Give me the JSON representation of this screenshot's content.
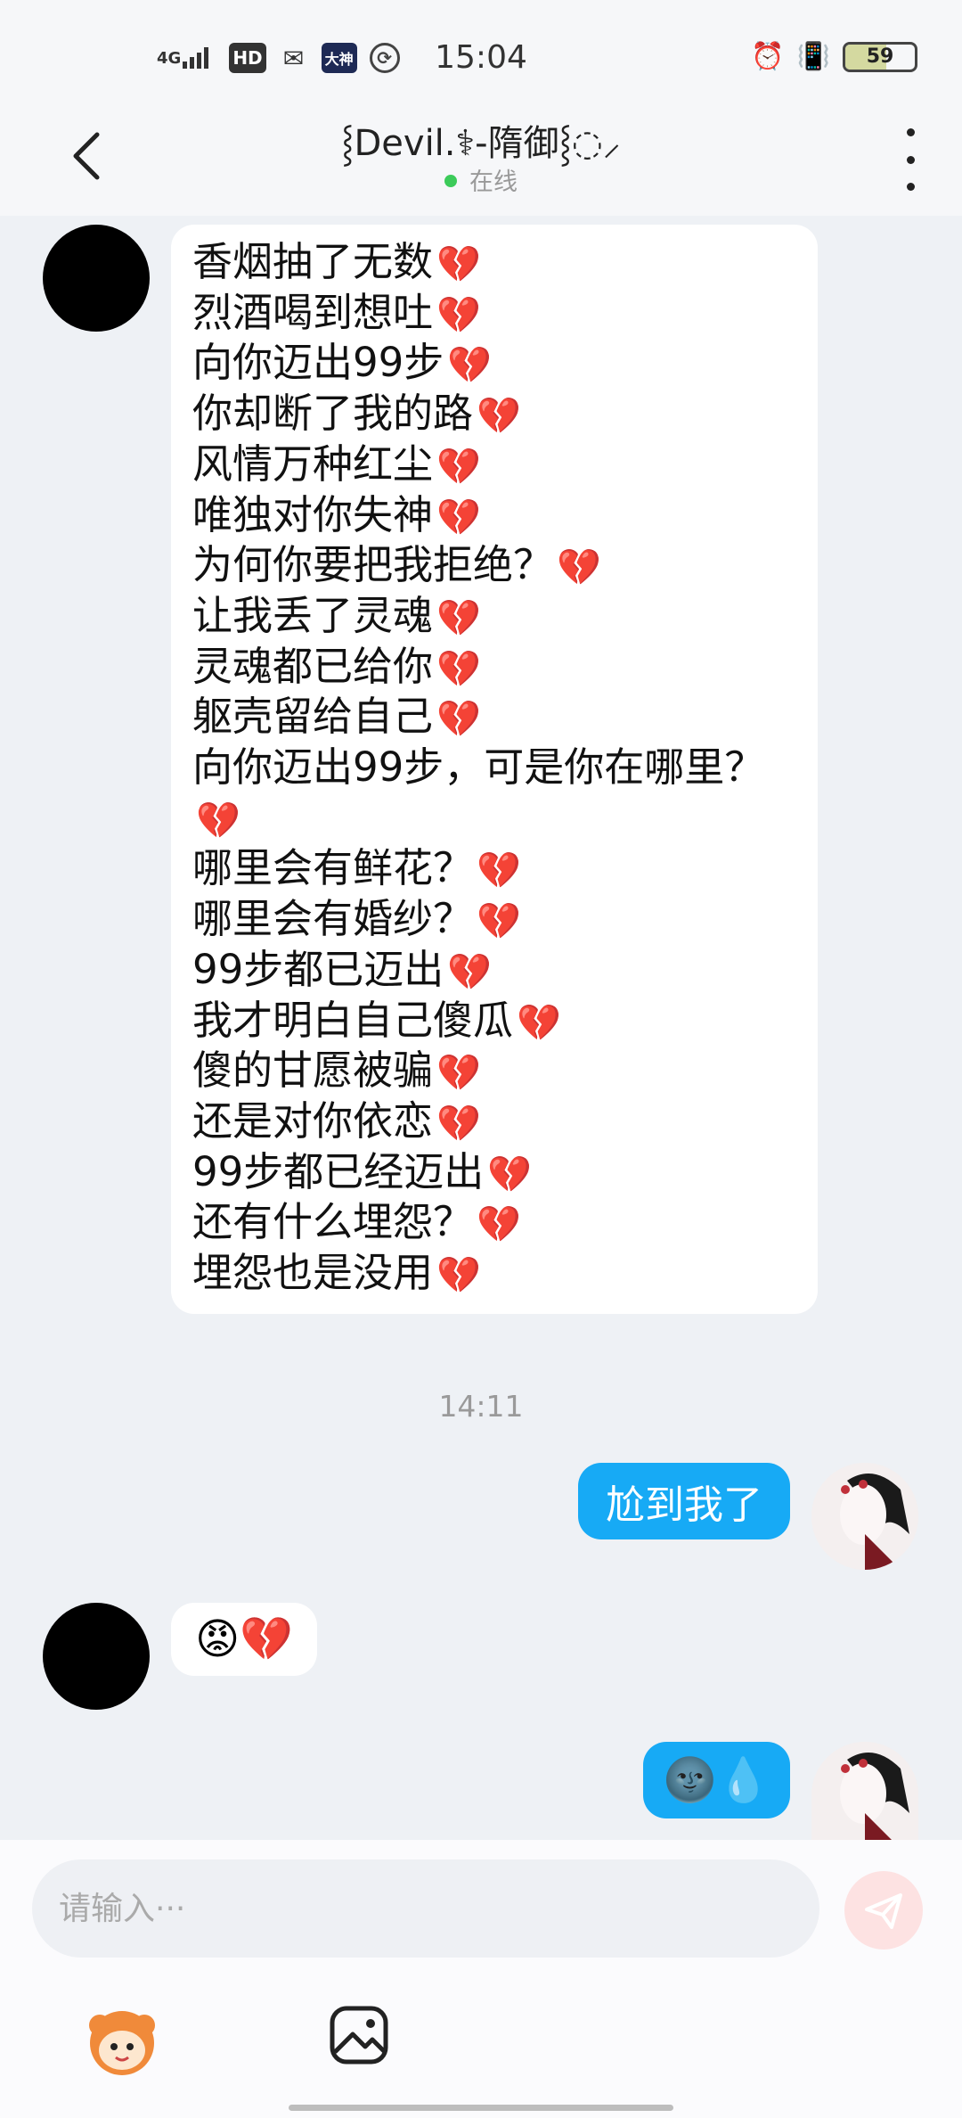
{
  "status_bar": {
    "network": "4G",
    "hd": "HD",
    "app_badge": "大神",
    "time": "15:04",
    "battery_level": 59,
    "battery_label": "59"
  },
  "header": {
    "title": "⸾Devil.⚕-隋御⸾◌⸝",
    "status": "在线"
  },
  "messages": [
    {
      "side": "left",
      "lines": [
        {
          "text": "香烟抽了无数",
          "emoji": "💔"
        },
        {
          "text": "烈酒喝到想吐",
          "emoji": "💔"
        },
        {
          "text": "向你迈出99步",
          "emoji": "💔"
        },
        {
          "text": "你却断了我的路",
          "emoji": "💔"
        },
        {
          "text": "风情万种红尘",
          "emoji": "💔"
        },
        {
          "text": "唯独对你失神",
          "emoji": "💔"
        },
        {
          "text": "为何你要把我拒绝？",
          "emoji": "💔"
        },
        {
          "text": "让我丢了灵魂",
          "emoji": "💔"
        },
        {
          "text": "灵魂都已给你",
          "emoji": "💔"
        },
        {
          "text": "躯壳留给自己",
          "emoji": "💔"
        },
        {
          "text": "向你迈出99步，可是你在哪里？",
          "emoji": ""
        },
        {
          "text": "",
          "emoji": "💔"
        },
        {
          "text": "哪里会有鲜花？",
          "emoji": "💔"
        },
        {
          "text": "哪里会有婚纱？",
          "emoji": "💔"
        },
        {
          "text": "99步都已迈出",
          "emoji": "💔"
        },
        {
          "text": "我才明白自己傻瓜",
          "emoji": "💔"
        },
        {
          "text": "傻的甘愿被骗",
          "emoji": "💔"
        },
        {
          "text": "还是对你依恋",
          "emoji": "💔"
        },
        {
          "text": "99步都已经迈出",
          "emoji": "💔"
        },
        {
          "text": "还有什么埋怨？",
          "emoji": "💔"
        },
        {
          "text": "埋怨也是没用",
          "emoji": "💔"
        }
      ]
    },
    {
      "side": "center",
      "type": "timestamp",
      "text": "14:11"
    },
    {
      "side": "right",
      "text": "尬到我了"
    },
    {
      "side": "left",
      "emojis": "😡💔"
    },
    {
      "side": "right",
      "emojis": "🌚💧"
    }
  ],
  "input": {
    "placeholder": "请输入···"
  },
  "icons": {
    "back": "chevron-left-icon",
    "more": "more-vertical-icon",
    "send": "send-icon",
    "mascot": "mascot-sticker-icon",
    "image": "image-icon"
  },
  "colors": {
    "outgoing_bubble": "#17aaf5",
    "online_dot": "#3ccb5a",
    "send_button_disabled": "#fde2e2"
  }
}
